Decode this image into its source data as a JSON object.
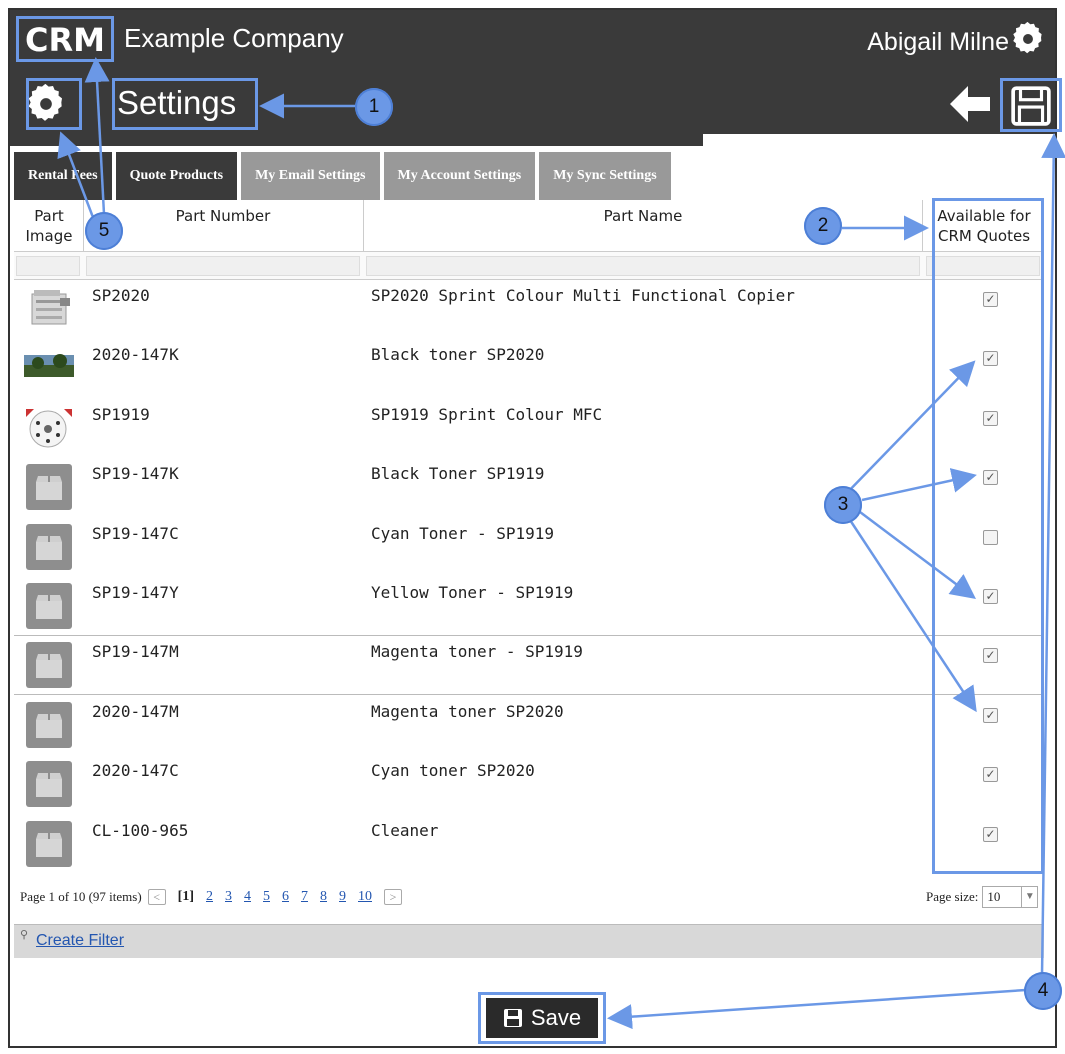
{
  "header": {
    "logo_text": "CRM",
    "company": "Example Company",
    "user": "Abigail Milne"
  },
  "settings": {
    "title": "Settings"
  },
  "tabs": [
    {
      "label": "Rental Fees"
    },
    {
      "label": "Quote Products"
    },
    {
      "label": "My Email Settings"
    },
    {
      "label": "My Account Settings"
    },
    {
      "label": "My Sync Settings"
    }
  ],
  "grid": {
    "columns": {
      "image_line1": "Part",
      "image_line2": "Image",
      "number": "Part Number",
      "name": "Part Name",
      "available_line1": "Available for",
      "available_line2": "CRM Quotes"
    },
    "rows": [
      {
        "number": "SP2020",
        "name": "SP2020 Sprint Colour Multi Functional Copier",
        "available": true,
        "image": "copier"
      },
      {
        "number": "2020-147K",
        "name": "Black toner SP2020",
        "available": true,
        "image": "landscape"
      },
      {
        "number": "SP1919",
        "name": "SP1919 Sprint Colour MFC",
        "available": true,
        "image": "dial"
      },
      {
        "number": "SP19-147K",
        "name": "Black Toner SP1919",
        "available": true,
        "image": "placeholder"
      },
      {
        "number": "SP19-147C",
        "name": "Cyan Toner - SP1919",
        "available": false,
        "image": "placeholder"
      },
      {
        "number": "SP19-147Y",
        "name": "Yellow Toner - SP1919",
        "available": true,
        "image": "placeholder"
      },
      {
        "number": "SP19-147M",
        "name": "Magenta toner - SP1919",
        "available": true,
        "image": "placeholder"
      },
      {
        "number": "2020-147M",
        "name": "Magenta toner SP2020",
        "available": true,
        "image": "placeholder"
      },
      {
        "number": "2020-147C",
        "name": "Cyan toner SP2020",
        "available": true,
        "image": "placeholder"
      },
      {
        "number": "CL-100-965",
        "name": "Cleaner",
        "available": true,
        "image": "placeholder"
      }
    ]
  },
  "pager": {
    "summary": "Page 1 of 10 (97 items)",
    "current": "[1]",
    "pages": [
      "2",
      "3",
      "4",
      "5",
      "6",
      "7",
      "8",
      "9",
      "10"
    ],
    "page_size_label": "Page size:",
    "page_size_value": "10"
  },
  "filter": {
    "link_label": "Create Filter"
  },
  "footer": {
    "save_label": "Save"
  },
  "annotations": [
    "1",
    "2",
    "3",
    "4",
    "5"
  ],
  "colors": {
    "dark_bar": "#3a3a3a",
    "tab_grey": "#999999",
    "annotation_blue": "#6b98e6",
    "link_blue": "#2356b0"
  }
}
